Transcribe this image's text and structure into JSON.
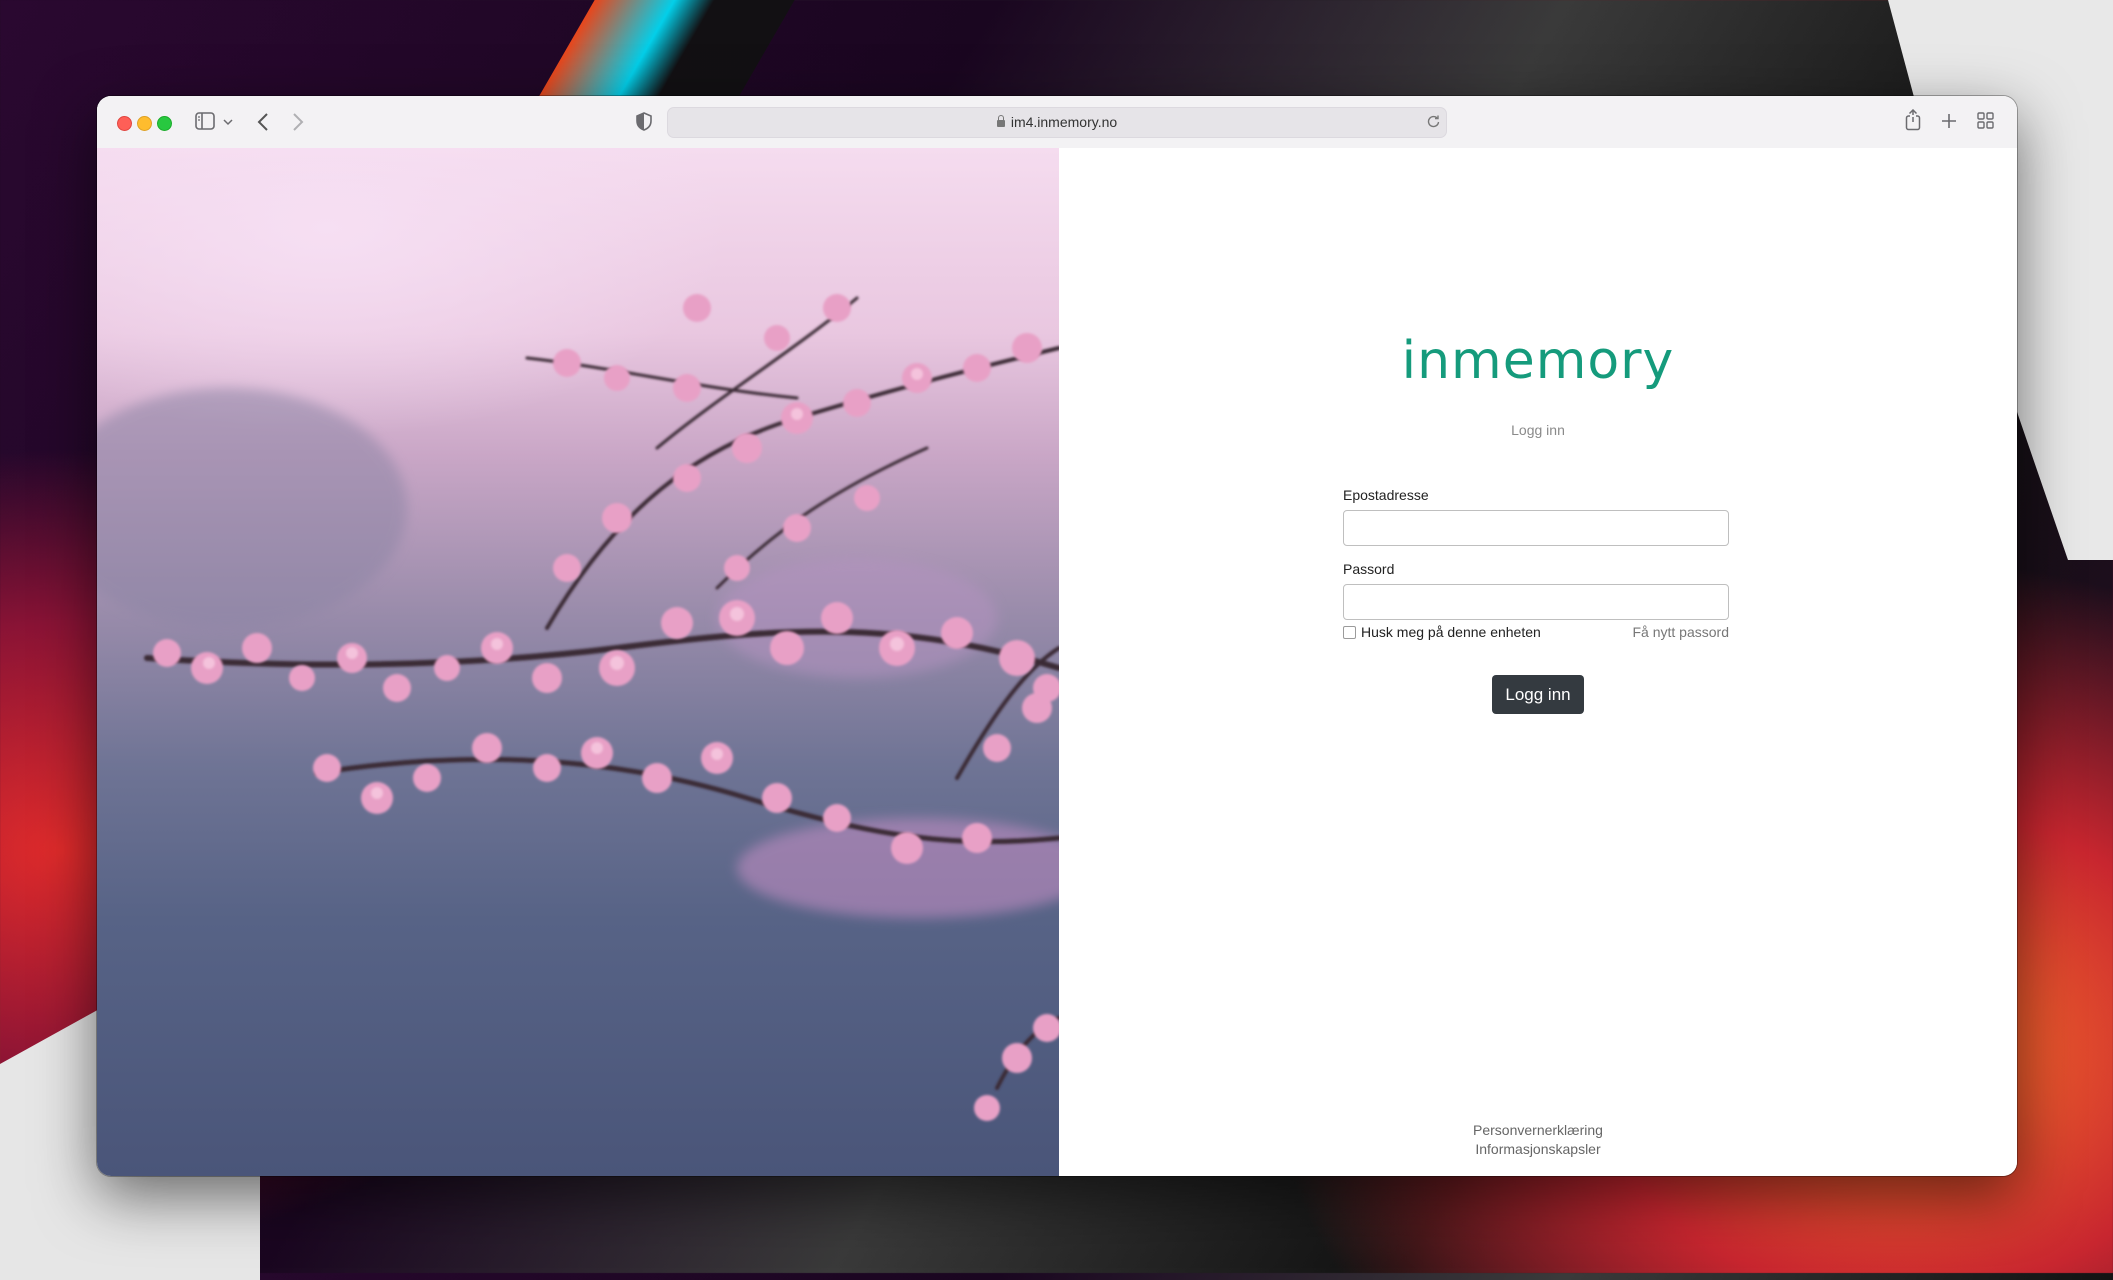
{
  "browser": {
    "url": "im4.inmemory.no"
  },
  "login": {
    "logo_text": "inmemory",
    "subtitle": "Logg inn",
    "email_label": "Epostadresse",
    "email_value": "",
    "password_label": "Passord",
    "password_value": "",
    "remember_label": "Husk meg på denne enheten",
    "remember_checked": false,
    "forgot_label": "Få nytt passord",
    "submit_label": "Logg inn"
  },
  "footer": {
    "privacy_label": "Personvernerklæring",
    "cookies_label": "Informasjonskapsler"
  },
  "colors": {
    "brand": "#159b7c",
    "button": "#343a40"
  }
}
